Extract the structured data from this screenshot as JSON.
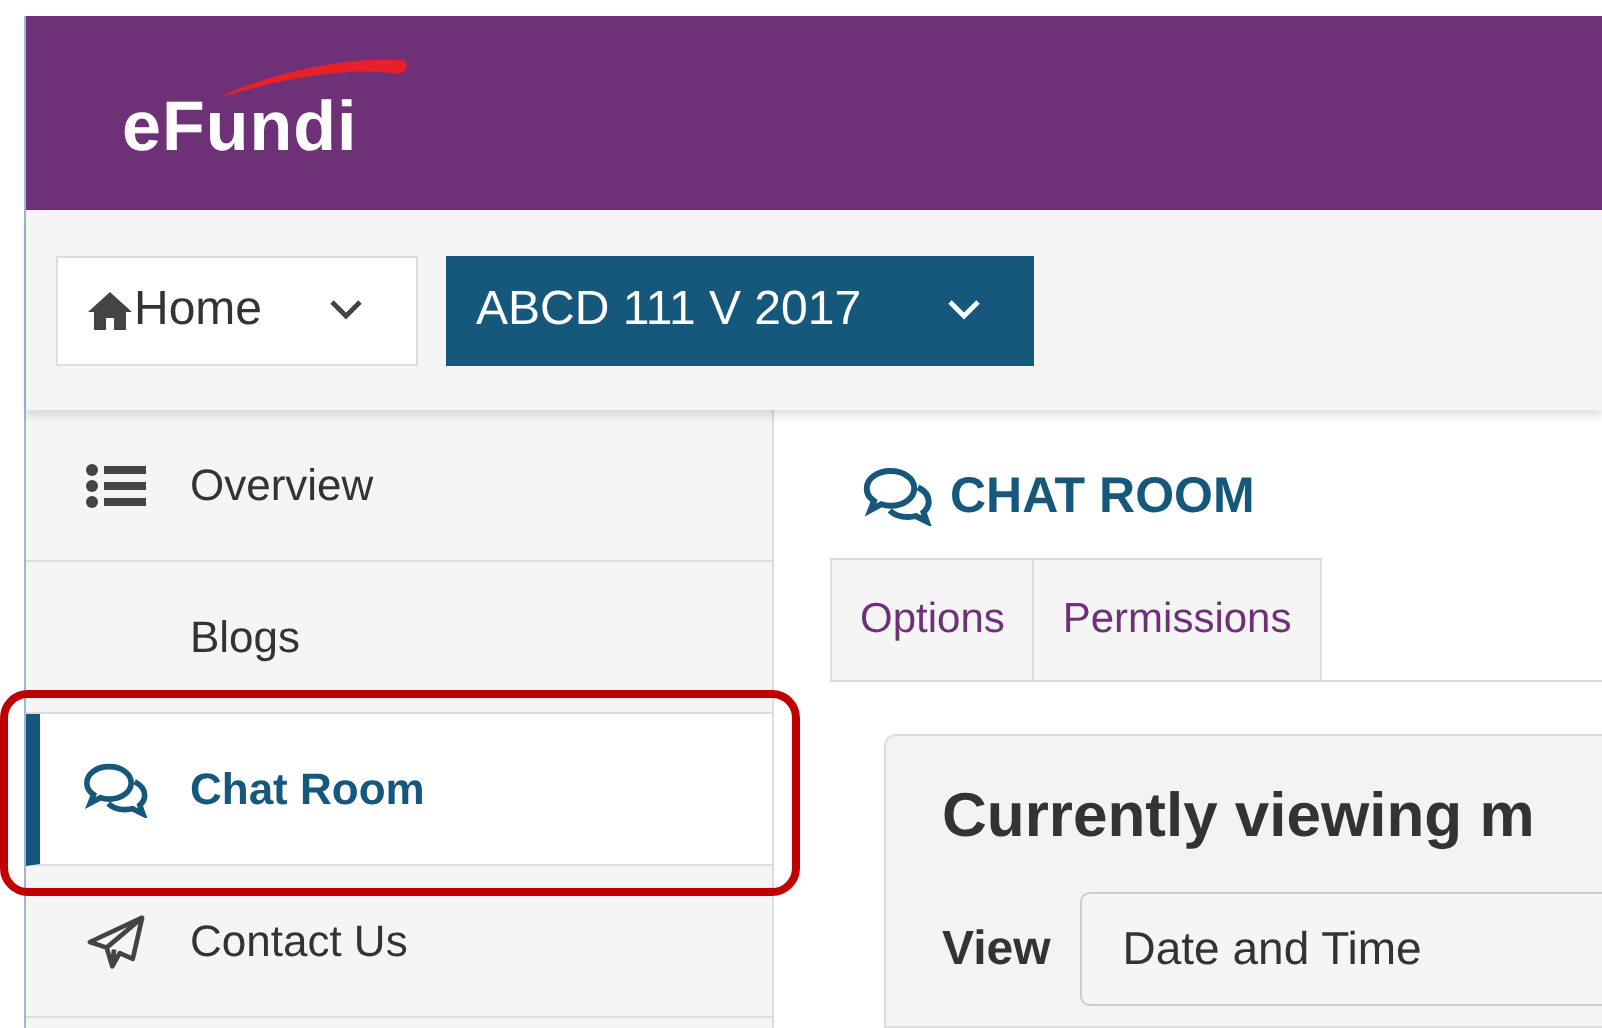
{
  "header": {
    "logo": "eFundi"
  },
  "nav": {
    "home": {
      "label": "Home"
    },
    "site": {
      "label": "ABCD 111 V 2017"
    }
  },
  "sidebar": {
    "items": [
      {
        "label": "Overview",
        "kind": "list",
        "selected": false,
        "highlighted": false
      },
      {
        "label": "Blogs",
        "kind": "plain",
        "selected": false,
        "highlighted": false
      },
      {
        "label": "Chat Room",
        "kind": "chat",
        "selected": true,
        "highlighted": true
      },
      {
        "label": "Contact Us",
        "kind": "send",
        "selected": false,
        "highlighted": false
      }
    ]
  },
  "main": {
    "title": "CHAT ROOM",
    "tabs": [
      {
        "label": "Options"
      },
      {
        "label": "Permissions"
      }
    ],
    "panel": {
      "heading": "Currently viewing m",
      "view_label": "View",
      "view_value": "Date and Time"
    }
  }
}
